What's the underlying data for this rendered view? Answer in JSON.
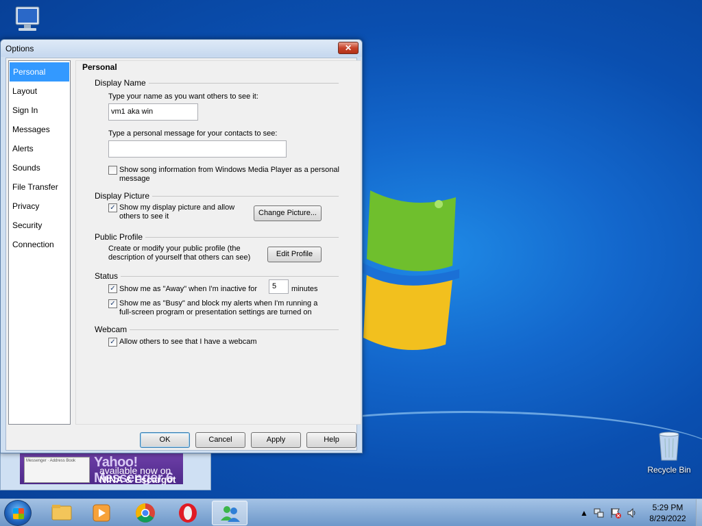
{
  "desktop": {
    "recycle_bin_label": "Recycle Bin"
  },
  "ad": {
    "line1": "Yahoo! Messenger 6",
    "line2": "available now on",
    "line3": "NINA & Escargot",
    "mini_text": "Messenger · Address Book"
  },
  "window": {
    "title": "Options",
    "close_label": "✕"
  },
  "sidebar": {
    "items": [
      {
        "label": "Personal",
        "selected": true
      },
      {
        "label": "Layout"
      },
      {
        "label": "Sign In"
      },
      {
        "label": "Messages"
      },
      {
        "label": "Alerts"
      },
      {
        "label": "Sounds"
      },
      {
        "label": "File Transfer"
      },
      {
        "label": "Privacy"
      },
      {
        "label": "Security"
      },
      {
        "label": "Connection"
      }
    ]
  },
  "panel": {
    "title": "Personal",
    "display_name": {
      "section": "Display Name",
      "name_prompt": "Type your name as you want others to see it:",
      "name_value": "vm1 aka win",
      "message_prompt": "Type a personal message for your contacts to see:",
      "message_value": "",
      "song_checkbox_label": "Show song information from Windows Media Player as a personal message",
      "song_checked": false
    },
    "display_picture": {
      "section": "Display Picture",
      "checkbox_label": "Show my display picture and allow others to see it",
      "checked": true,
      "button": "Change Picture..."
    },
    "public_profile": {
      "section": "Public Profile",
      "description": "Create or modify your public profile (the description of yourself that others can see)",
      "button": "Edit Profile"
    },
    "status": {
      "section": "Status",
      "away_label": "Show me as \"Away\" when I'm inactive for",
      "away_checked": true,
      "away_minutes": "5",
      "minutes_label": "minutes",
      "busy_label": "Show me as \"Busy\" and block my alerts when I'm running a full-screen program or presentation settings are turned on",
      "busy_checked": true
    },
    "webcam": {
      "section": "Webcam",
      "label": "Allow others to see that I have a webcam",
      "checked": true
    }
  },
  "buttons": {
    "ok": "OK",
    "cancel": "Cancel",
    "apply": "Apply",
    "help": "Help"
  },
  "taskbar": {
    "time": "5:29 PM",
    "date": "8/29/2022"
  },
  "colors": {
    "selection": "#3399ff",
    "desktop": "#0a4fb0"
  }
}
